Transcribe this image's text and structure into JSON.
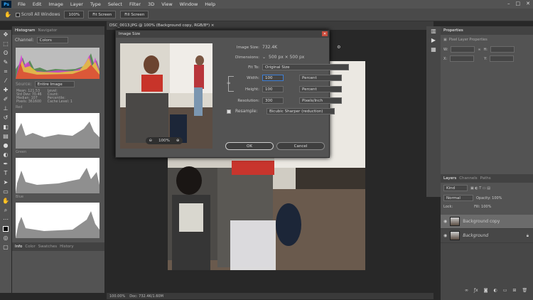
{
  "menubar": {
    "logo": "Ps",
    "items": [
      "File",
      "Edit",
      "Image",
      "Layer",
      "Type",
      "Select",
      "Filter",
      "3D",
      "View",
      "Window",
      "Help"
    ]
  },
  "options": {
    "scroll_all": "Scroll All Windows",
    "zoom": "100%",
    "fit_screen": "Fit Screen",
    "fill_screen": "Fill Screen"
  },
  "document": {
    "tab": "DSC_0013.JPG @ 100% (Background copy, RGB/8*) ×"
  },
  "histogram": {
    "tabs": [
      "Histogram",
      "Navigator"
    ],
    "channel_label": "Channel:",
    "channel": "Colors",
    "source": "Entire Image",
    "labels": [
      "Red",
      "Green",
      "Blue"
    ],
    "stats_left": [
      "Mean: 121.53",
      "Std Dev: 70.46",
      "Median: 107",
      "Pixels: 361600"
    ],
    "stats_right": [
      "Level:",
      "Count:",
      "Percentile:",
      "Cache Level: 1"
    ]
  },
  "left_bottom_tabs": [
    "Info",
    "Color",
    "Swatches",
    "History"
  ],
  "dialog": {
    "title": "Image Size",
    "image_size_label": "Image Size:",
    "image_size": "732.4K",
    "dimensions_label": "Dimensions:",
    "dimensions": "500 px × 500 px",
    "fit_to_label": "Fit To:",
    "fit_to": "Original Size",
    "width_label": "Width:",
    "width": "100",
    "width_unit": "Percent",
    "height_label": "Height:",
    "height": "100",
    "height_unit": "Percent",
    "resolution_label": "Resolution:",
    "resolution": "300",
    "resolution_unit": "Pixels/Inch",
    "resample_label": "Resample:",
    "resample": "Bicubic Sharper (reduction)",
    "zoom": "100%",
    "ok": "OK",
    "cancel": "Cancel"
  },
  "properties": {
    "tab": "Properties",
    "header": "Pixel Layer Properties",
    "w": "W:",
    "h": "H:",
    "x": "X:",
    "y": "Y:"
  },
  "layers": {
    "tabs": [
      "Layers",
      "Channels",
      "Paths"
    ],
    "kind": "Kind",
    "mode": "Normal",
    "opacity": "Opacity: 100%",
    "lock": "Lock:",
    "fill": "Fill: 100%",
    "items": [
      "Background copy",
      "Background"
    ]
  },
  "status": {
    "zoom": "100.00%",
    "doc": "Doc: 732.4K/1.60M"
  }
}
